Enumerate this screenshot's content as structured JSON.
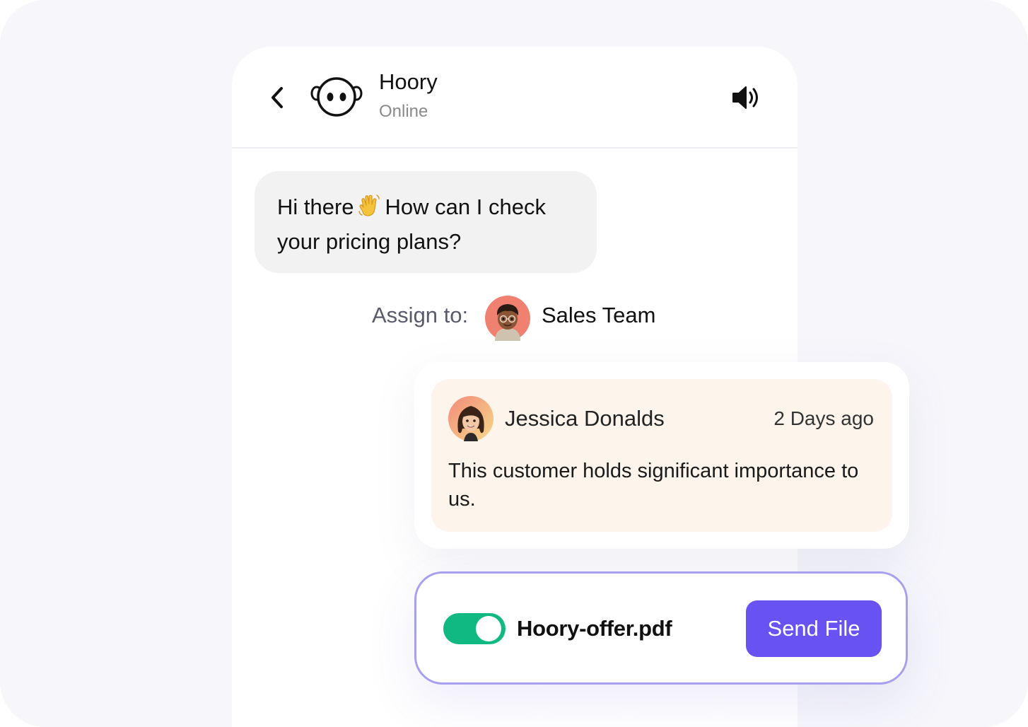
{
  "header": {
    "name": "Hoory",
    "status": "Online",
    "back_icon": "chevron-left-icon",
    "bot_avatar_icon": "hoory-bot-icon",
    "sound_icon": "speaker-icon"
  },
  "message": {
    "line1_prefix": "Hi there",
    "line1_suffix": "How can I check",
    "line2": "your pricing plans?",
    "emoji_icon": "waving-hand-icon"
  },
  "assign": {
    "label": "Assign to:",
    "team": "Sales Team"
  },
  "note": {
    "author": "Jessica Donalds",
    "time": "2 Days ago",
    "text": "This customer holds significant importance to us."
  },
  "file": {
    "toggle_on": true,
    "name": "Hoory-offer.pdf",
    "send_label": "Send File"
  },
  "colors": {
    "accent": "#6853f2",
    "toggle": "#10b981",
    "note_bg": "#fdf5ec",
    "file_border": "#a7a0ee"
  }
}
